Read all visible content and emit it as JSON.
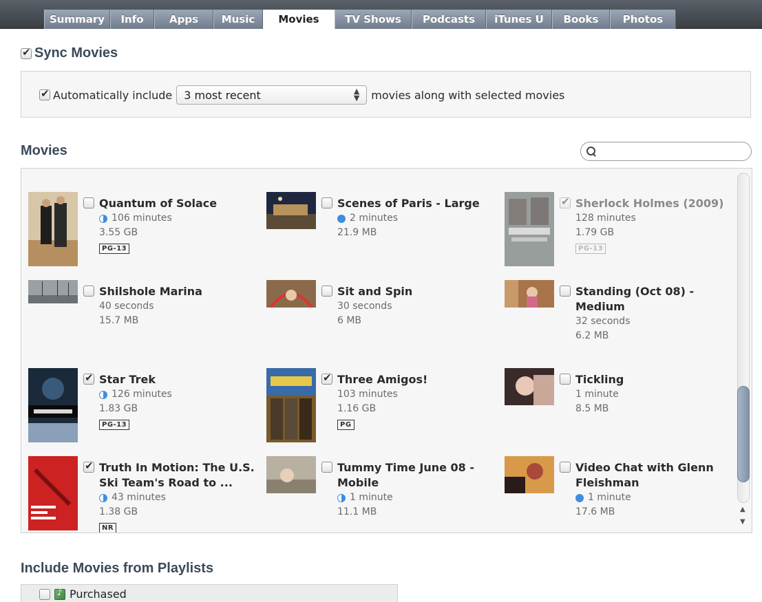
{
  "tabs": [
    {
      "label": "Summary",
      "active": false
    },
    {
      "label": "Info",
      "active": false
    },
    {
      "label": "Apps",
      "active": false
    },
    {
      "label": "Music",
      "active": false
    },
    {
      "label": "Movies",
      "active": true
    },
    {
      "label": "TV Shows",
      "active": false
    },
    {
      "label": "Podcasts",
      "active": false
    },
    {
      "label": "iTunes U",
      "active": false
    },
    {
      "label": "Books",
      "active": false
    },
    {
      "label": "Photos",
      "active": false
    }
  ],
  "sync": {
    "label": "Sync Movies",
    "checked": true
  },
  "auto_include": {
    "label": "Automatically include",
    "checked": true,
    "selected": "3 most recent",
    "after": "movies along with selected movies"
  },
  "movies_section": {
    "title": "Movies",
    "search_placeholder": ""
  },
  "movies": [
    {
      "title": "Quantum of Solace",
      "duration": "106 minutes",
      "size": "3.55 GB",
      "rating": "PG-13",
      "checked": false,
      "dim": false,
      "progress": "half",
      "thumb": "poster-quantum"
    },
    {
      "title": "Scenes of Paris - Large",
      "duration": "2 minutes",
      "size": "21.9 MB",
      "rating": "",
      "checked": false,
      "dim": false,
      "progress": "full",
      "thumb": "video-paris"
    },
    {
      "title": "Sherlock Holmes (2009)",
      "duration": "128 minutes",
      "size": "1.79 GB",
      "rating": "PG-13",
      "checked": true,
      "dim": true,
      "progress": "",
      "thumb": "poster-sherlock"
    },
    {
      "title": "Shilshole Marina",
      "duration": "40 seconds",
      "size": "15.7 MB",
      "rating": "",
      "checked": false,
      "dim": false,
      "progress": "",
      "thumb": "video-marina"
    },
    {
      "title": "Sit and Spin",
      "duration": "30 seconds",
      "size": "6 MB",
      "rating": "",
      "checked": false,
      "dim": false,
      "progress": "",
      "thumb": "video-spin"
    },
    {
      "title": "Standing (Oct 08) - Medium",
      "duration": "32 seconds",
      "size": "6.2 MB",
      "rating": "",
      "checked": false,
      "dim": false,
      "progress": "",
      "thumb": "video-standing"
    },
    {
      "title": "Star Trek",
      "duration": "126 minutes",
      "size": "1.83 GB",
      "rating": "PG-13",
      "checked": true,
      "dim": false,
      "progress": "half",
      "thumb": "poster-startrek"
    },
    {
      "title": "Three Amigos!",
      "duration": "103 minutes",
      "size": "1.16 GB",
      "rating": "PG",
      "checked": true,
      "dim": false,
      "progress": "",
      "thumb": "poster-amigos"
    },
    {
      "title": "Tickling",
      "duration": "1 minute",
      "size": "8.5 MB",
      "rating": "",
      "checked": false,
      "dim": false,
      "progress": "",
      "thumb": "video-tickling"
    },
    {
      "title": "Truth In Motion: The U.S. Ski Team's Road to ...",
      "duration": "43 minutes",
      "size": "1.38 GB",
      "rating": "NR",
      "checked": true,
      "dim": false,
      "progress": "half",
      "thumb": "poster-truth"
    },
    {
      "title": "Tummy Time June 08 - Mobile",
      "duration": "1 minute",
      "size": "11.1 MB",
      "rating": "",
      "checked": false,
      "dim": false,
      "progress": "half",
      "thumb": "video-tummy"
    },
    {
      "title": "Video Chat with Glenn Fleishman",
      "duration": "1 minute",
      "size": "17.6 MB",
      "rating": "",
      "checked": false,
      "dim": false,
      "progress": "full",
      "thumb": "video-chat"
    }
  ],
  "playlists": {
    "title": "Include Movies from Playlists",
    "items": [
      {
        "label": "Purchased",
        "checked": false,
        "icon": "purchased-playlist-icon"
      }
    ]
  },
  "colors": {
    "accent_blue": "#3d8ee0",
    "section_title": "#3b4a5a",
    "tab_bar": "#3b3f45"
  }
}
